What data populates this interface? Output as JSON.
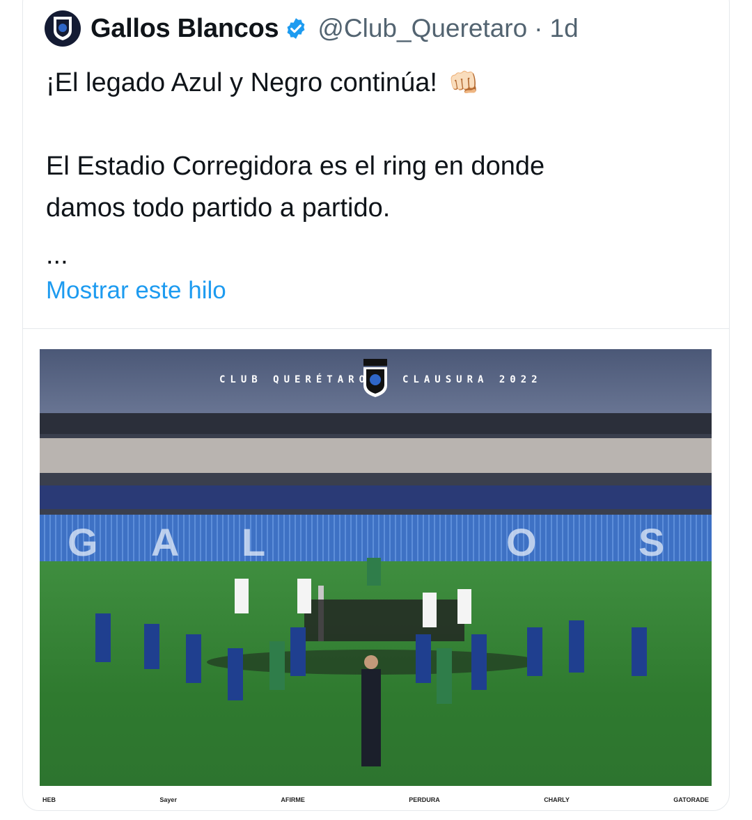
{
  "tweet": {
    "display_name": "Gallos Blancos",
    "handle": "@Club_Queretaro",
    "separator": "·",
    "time": "1d",
    "line1": "¡El legado Azul y Negro continúa!",
    "emoji": "👊🏻",
    "line2": "El Estadio Corregidora es el ring en donde",
    "line3": "damos todo partido a partido.",
    "ellipsis": "...",
    "show_thread": "Mostrar este hilo"
  },
  "media": {
    "title_left": "CLUB QUERÉTARO",
    "title_right": "CLAUSURA 2022",
    "stand_letters": [
      "G",
      "A",
      "L",
      "O",
      "S"
    ],
    "sponsors": [
      "HEB",
      "Sayer",
      "AFIRME",
      "PERDURA",
      "CHARLY",
      "GATORADE"
    ]
  },
  "colors": {
    "link": "#1d9bf0",
    "verified": "#1d9bf0",
    "text": "#0f1419",
    "secondary": "#536471"
  }
}
